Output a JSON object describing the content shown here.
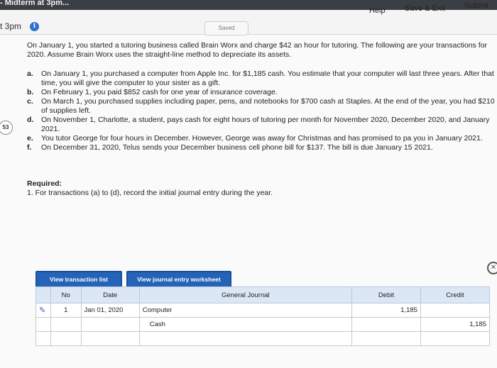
{
  "topbar": {
    "title": "- Midterm at 3pm..."
  },
  "header": {
    "saved": "Saved",
    "help": "Help",
    "save_exit": "Save & Exit",
    "submit": "Submit"
  },
  "timer": "t 3pm",
  "question_number": "53",
  "problem": {
    "intro": "On January 1, you started a tutoring business called Brain Worx and charge $42 an hour for tutoring. The following are your transactions for 2020. Assume Brain Worx uses the straight-line method to depreciate its assets.",
    "items": [
      {
        "letter": "a.",
        "text": "On January 1, you purchased a computer from Apple Inc. for $1,185 cash. You estimate that your computer will last three years. After that time, you will give the computer to your sister as a gift."
      },
      {
        "letter": "b.",
        "text": "On February 1, you paid $852 cash for one year of insurance coverage."
      },
      {
        "letter": "c.",
        "text": "On March 1, you purchased supplies including paper, pens, and notebooks for $700 cash at Staples. At the end of the year, you had $210 of supplies left."
      },
      {
        "letter": "d.",
        "text": "On November 1, Charlotte, a student, pays cash for eight hours of tutoring per month for November 2020, December 2020, and January 2021."
      },
      {
        "letter": "e.",
        "text": "You tutor George for four hours in December. However, George was away for Christmas and has promised to pa you in January 2021."
      },
      {
        "letter": "f.",
        "text": "On December 31, 2020, Telus sends your December business cell phone bill for $137. The bill is due January 15 2021."
      }
    ],
    "required_label": "Required:",
    "required_text": "1. For transactions (a) to (d), record the initial journal entry during the year."
  },
  "buttons": {
    "view_transaction_list": "View transaction list",
    "view_journal_worksheet": "View journal entry worksheet"
  },
  "journal": {
    "headers": {
      "no": "No",
      "date": "Date",
      "general_journal": "General Journal",
      "debit": "Debit",
      "credit": "Credit"
    },
    "rows": [
      {
        "no": "1",
        "date": "Jan 01, 2020",
        "account": "Computer",
        "debit": "1,185",
        "credit": ""
      },
      {
        "no": "",
        "date": "",
        "account": "Cash",
        "debit": "",
        "credit": "1,185"
      },
      {
        "no": "",
        "date": "",
        "account": "",
        "debit": "",
        "credit": ""
      }
    ]
  },
  "colors": {
    "accent": "#2463b8",
    "table_header": "#dce7f5"
  }
}
